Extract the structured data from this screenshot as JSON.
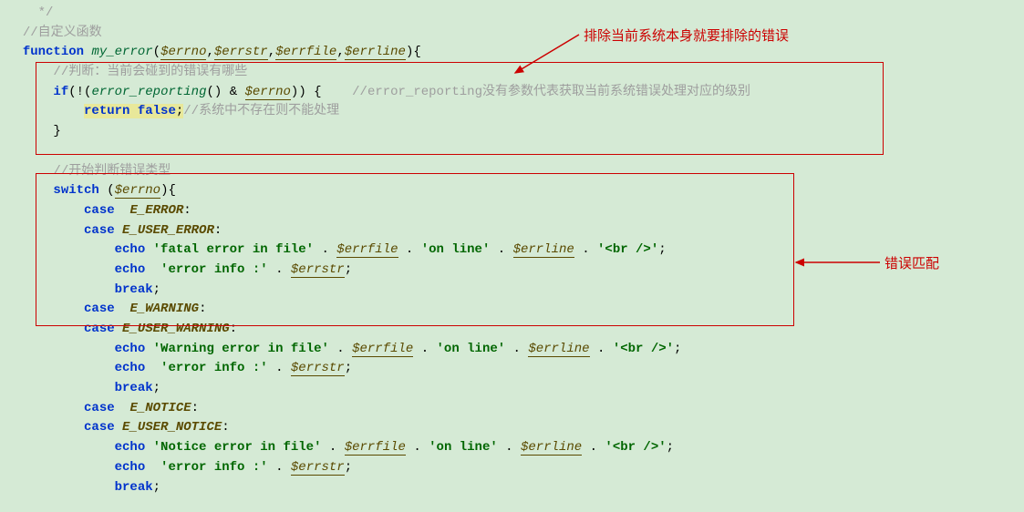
{
  "annotations": {
    "top_note": "排除当前系统本身就要排除的错误",
    "right_note": "错误匹配"
  },
  "code": {
    "l1_cmt": " */",
    "l2_cmt": "//自定义函数",
    "l3_kw": "function",
    "l3_fn": "my_error",
    "l3_v1": "$errno",
    "l3_v2": "$errstr",
    "l3_v3": "$errfile",
    "l3_v4": "$errline",
    "l4_cmt": "//判断：当前会碰到的错误有哪些",
    "l5_kw": "if",
    "l5_fn": "error_reporting",
    "l5_var": "$errno",
    "l5_cmt": "//error_reporting没有参数代表获取当前系统错误处理对应的级别",
    "l6_kw": "return",
    "l6_bool": "false",
    "l6_cmt": "//系统中不存在则不能处理",
    "l9_cmt": "//开始判断错误类型",
    "l10_kw": "switch",
    "l10_var": "$errno",
    "case_kw": "case",
    "echo_kw": "echo",
    "break_kw": "break",
    "c_error": "E_ERROR",
    "c_user_error": "E_USER_ERROR",
    "c_warning": "E_WARNING",
    "c_user_warning": "E_USER_WARNING",
    "c_notice": "E_NOTICE",
    "c_user_notice": "E_USER_NOTICE",
    "s_fatal": "'fatal error in file'",
    "s_warning": "'Warning error in file'",
    "s_notice": "'Notice error in file'",
    "s_online": "'on line'",
    "s_br": "'<br />'",
    "s_info": "'error info :'",
    "v_errfile": "$errfile",
    "v_errline": "$errline",
    "v_errstr": "$errstr"
  }
}
